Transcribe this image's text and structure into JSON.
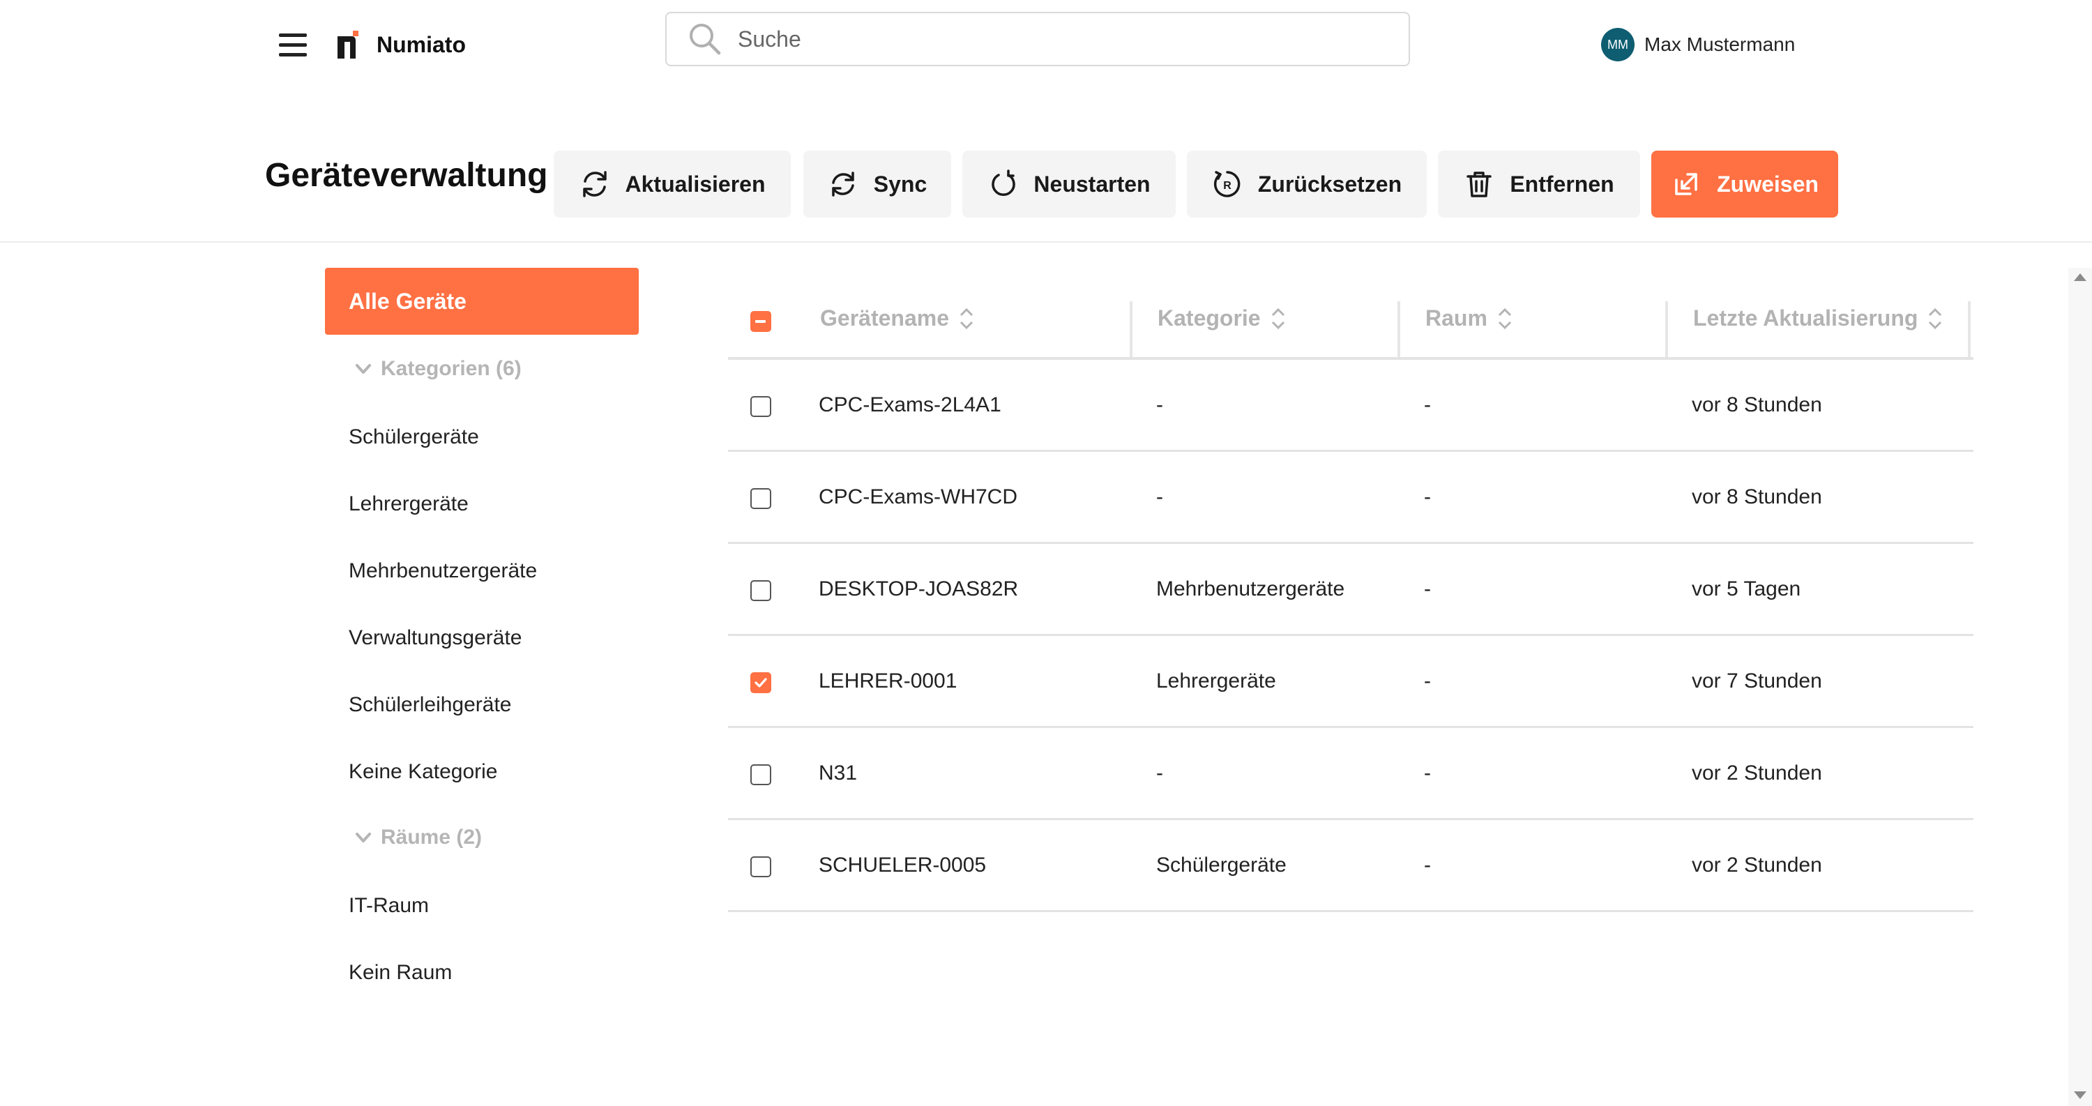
{
  "header": {
    "brand": "Numiato",
    "search_placeholder": "Suche",
    "user_initials": "MM",
    "user_name": "Max Mustermann"
  },
  "toolbar": {
    "title": "Geräteverwaltung",
    "buttons": {
      "refresh": "Aktualisieren",
      "sync": "Sync",
      "restart": "Neustarten",
      "reset": "Zurücksetzen",
      "remove": "Entfernen",
      "assign": "Zuweisen"
    }
  },
  "sidebar": {
    "all_devices": "Alle Geräte",
    "categories_header": "Kategorien (6)",
    "categories": [
      "Schülergeräte",
      "Lehrergeräte",
      "Mehrbenutzergeräte",
      "Verwaltungsgeräte",
      "Schülerleihgeräte",
      "Keine Kategorie"
    ],
    "rooms_header": "Räume (2)",
    "rooms": [
      "IT-Raum",
      "Kein Raum"
    ]
  },
  "table": {
    "columns": [
      "Gerätename",
      "Kategorie",
      "Raum",
      "Letzte Aktualisierung"
    ],
    "rows": [
      {
        "name": "CPC-Exams-2L4A1",
        "category": "-",
        "room": "-",
        "updated": "vor 8 Stunden",
        "checked": false
      },
      {
        "name": "CPC-Exams-WH7CD",
        "category": "-",
        "room": "-",
        "updated": "vor 8 Stunden",
        "checked": false
      },
      {
        "name": "DESKTOP-JOAS82R",
        "category": "Mehrbenutzergeräte",
        "room": "-",
        "updated": "vor 5 Tagen",
        "checked": false
      },
      {
        "name": "LEHRER-0001",
        "category": "Lehrergeräte",
        "room": "-",
        "updated": "vor 7 Stunden",
        "checked": true
      },
      {
        "name": "N31",
        "category": "-",
        "room": "-",
        "updated": "vor 2 Stunden",
        "checked": false
      },
      {
        "name": "SCHUELER-0005",
        "category": "Schülergeräte",
        "room": "-",
        "updated": "vor 2 Stunden",
        "checked": false
      }
    ]
  },
  "colors": {
    "accent": "#ff7043",
    "avatar": "#0e5d71"
  }
}
